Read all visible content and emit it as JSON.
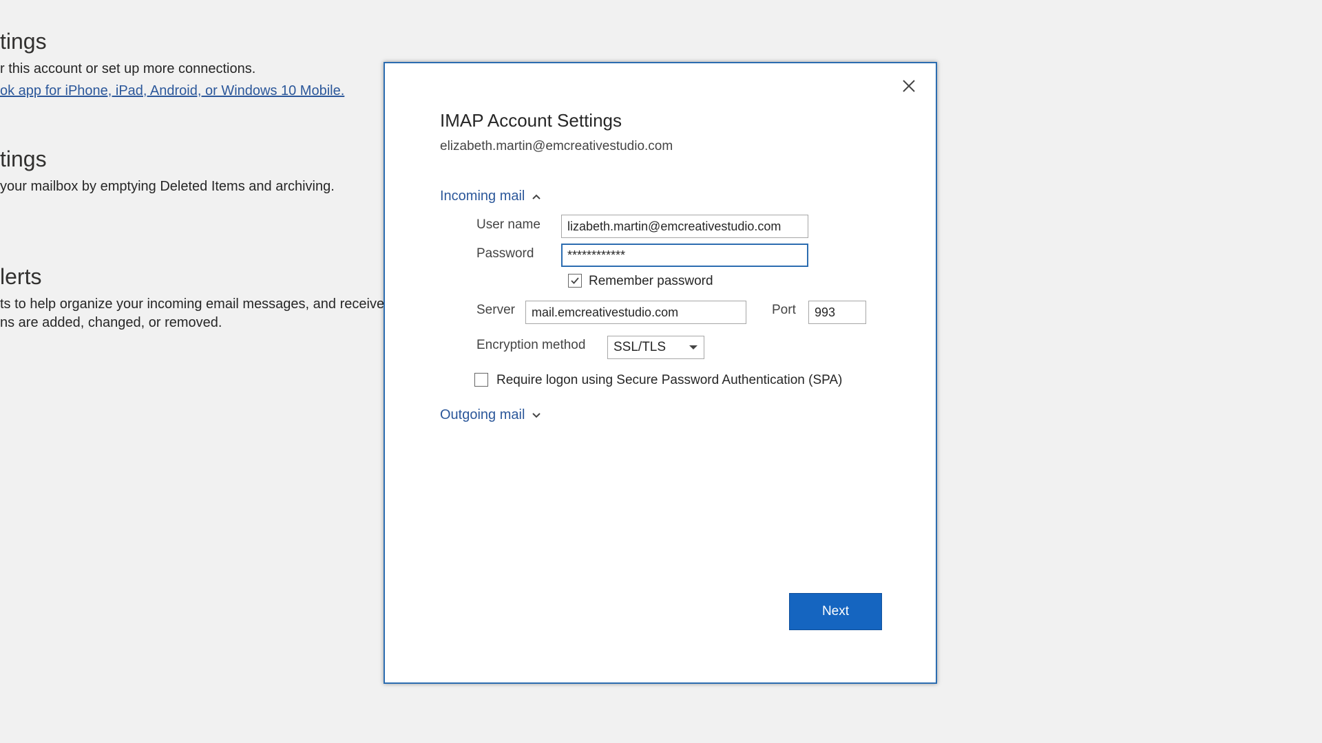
{
  "background": {
    "sections": [
      {
        "heading": "tings",
        "lines": [
          "r this account or set up more connections."
        ],
        "link": "ok app for iPhone, iPad, Android, or Windows 10 Mobile."
      },
      {
        "heading": "tings",
        "lines": [
          " your mailbox by emptying Deleted Items and archiving."
        ]
      },
      {
        "heading": "lerts",
        "lines": [
          "ts to help organize your incoming email messages, and receive",
          "ns are added, changed, or removed."
        ]
      }
    ]
  },
  "dialog": {
    "title": "IMAP Account Settings",
    "account_email": "elizabeth.martin@emcreativestudio.com",
    "incoming": {
      "label": "Incoming mail",
      "username_label": "User name",
      "username_value": "lizabeth.martin@emcreativestudio.com",
      "password_label": "Password",
      "password_value": "************",
      "remember_label": "Remember password",
      "remember_checked": true,
      "server_label": "Server",
      "server_value": "mail.emcreativestudio.com",
      "port_label": "Port",
      "port_value": "993",
      "encryption_label": "Encryption method",
      "encryption_value": "SSL/TLS",
      "spa_label": "Require logon using Secure Password Authentication (SPA)",
      "spa_checked": false
    },
    "outgoing": {
      "label": "Outgoing mail"
    },
    "next_label": "Next"
  },
  "colors": {
    "accent": "#1565c0",
    "link": "#2b579a",
    "background": "#f1f1f1"
  },
  "icons": {
    "close": "close-icon",
    "expanded": "chevron-up-icon",
    "collapsed": "chevron-down-icon",
    "dropdown": "dropdown-arrow-icon",
    "check": "checkmark-icon"
  }
}
